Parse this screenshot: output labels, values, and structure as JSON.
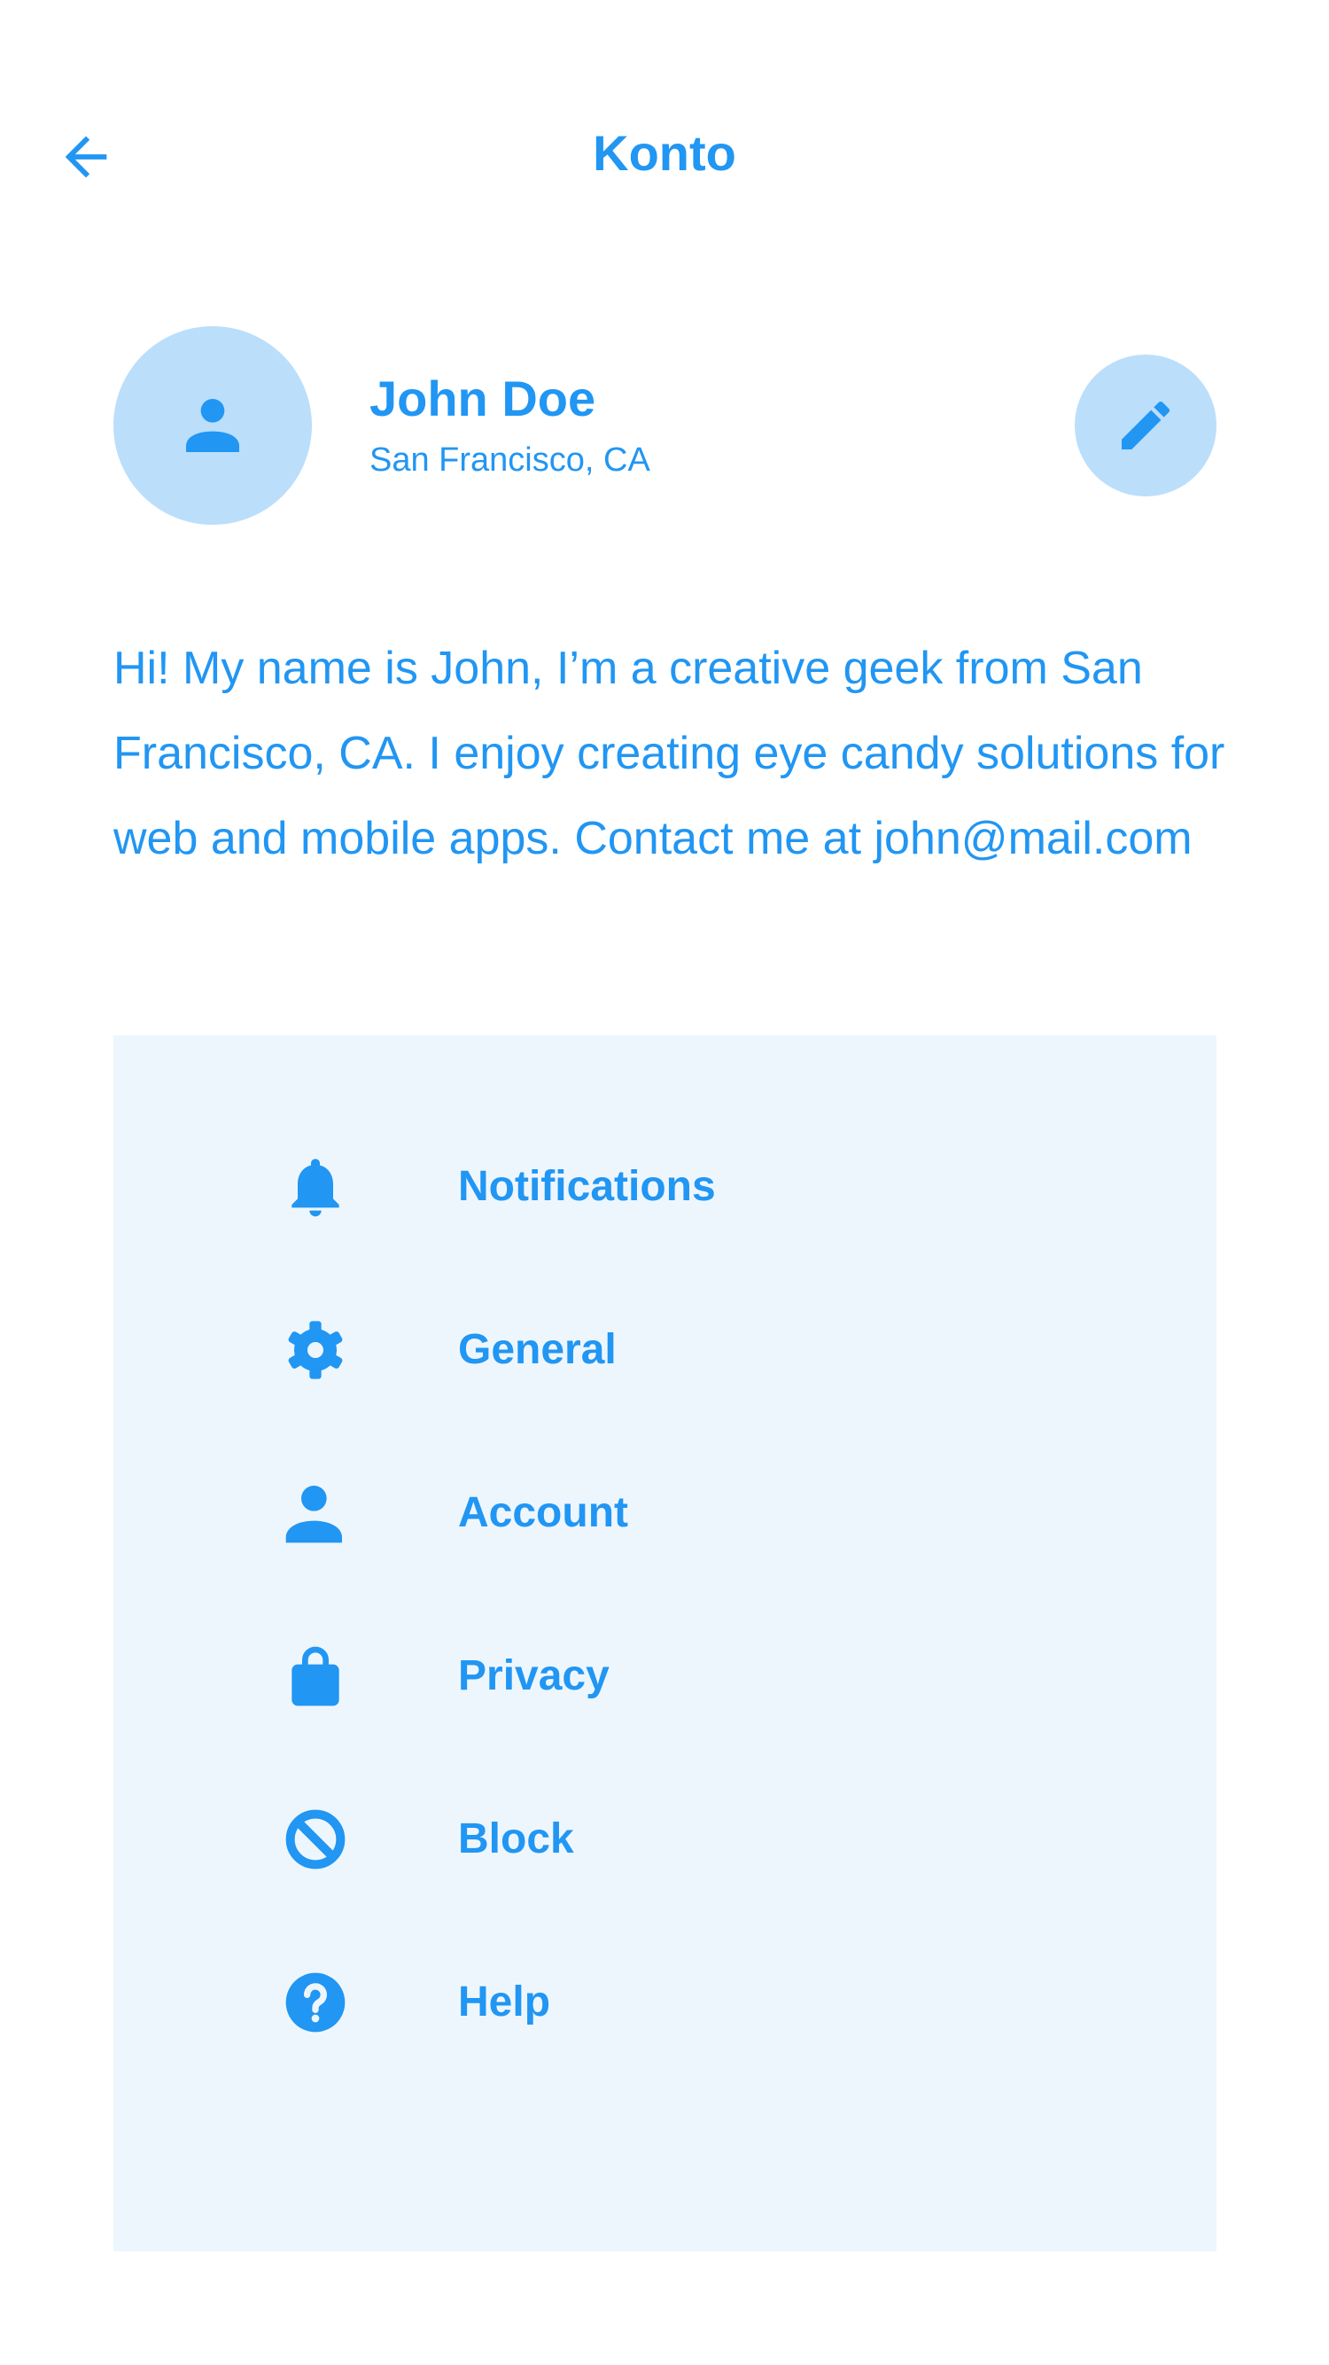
{
  "header": {
    "title": "Konto",
    "back_icon": "arrow-left-icon"
  },
  "profile": {
    "name": "John Doe",
    "location": "San Francisco, CA",
    "avatar_icon": "person-icon",
    "edit_icon": "pencil-icon"
  },
  "bio": "Hi! My name is John, I’m a creative geek from San Francisco, CA. I enjoy creating eye candy solutions for web and mobile apps. Contact me at john@mail.com",
  "menu": {
    "items": [
      {
        "label": "Notifications",
        "icon": "bell-icon"
      },
      {
        "label": "General",
        "icon": "gear-icon"
      },
      {
        "label": "Account",
        "icon": "person-icon"
      },
      {
        "label": "Privacy",
        "icon": "bag-icon"
      },
      {
        "label": "Block",
        "icon": "block-icon"
      },
      {
        "label": "Help",
        "icon": "help-icon"
      }
    ]
  },
  "colors": {
    "accent": "#2196f3",
    "avatar_bg": "#bbdefb",
    "panel_bg": "#eef6fd",
    "page_bg": "#ffffff"
  }
}
